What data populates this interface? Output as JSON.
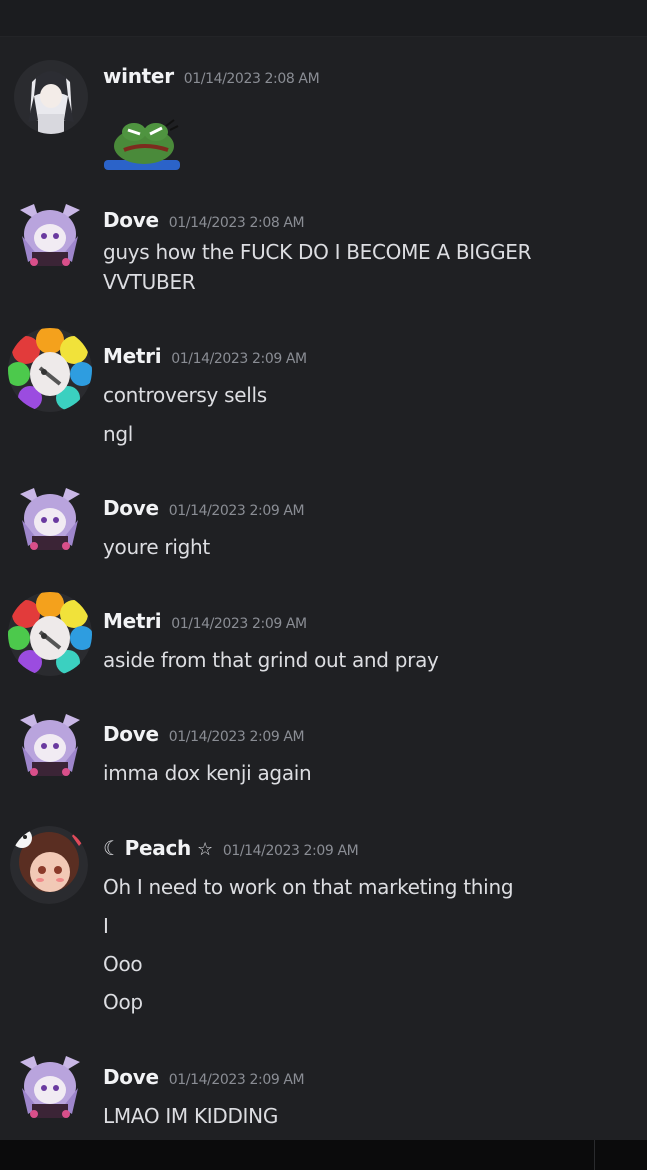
{
  "messages": [
    {
      "username": "winter",
      "timestamp": "01/14/2023 2:08 AM",
      "avatar": "winter-avatar",
      "lines": [],
      "emoji": "pepe-emoji"
    },
    {
      "username": "Dove",
      "timestamp": "01/14/2023 2:08 AM",
      "avatar": "dove-avatar",
      "lines": [
        "guys how the FUCK DO I BECOME A BIGGER",
        "VVTUBER"
      ]
    },
    {
      "username": "Metri",
      "timestamp": "01/14/2023 2:09 AM",
      "avatar": "metri-avatar",
      "lines": [
        "controversy sells",
        "ngl"
      ]
    },
    {
      "username": "Dove",
      "timestamp": "01/14/2023 2:09 AM",
      "avatar": "dove-avatar",
      "lines": [
        "youre right"
      ]
    },
    {
      "username": "Metri",
      "timestamp": "01/14/2023 2:09 AM",
      "avatar": "metri-avatar",
      "lines": [
        "aside from that grind out and pray"
      ]
    },
    {
      "username": "Dove",
      "timestamp": "01/14/2023 2:09 AM",
      "avatar": "dove-avatar",
      "lines": [
        "imma dox kenji again"
      ]
    },
    {
      "username": "Peach",
      "username_prefix": "☾",
      "username_suffix": "☆",
      "timestamp": "01/14/2023 2:09 AM",
      "avatar": "peach-avatar",
      "lines": [
        "Oh I need to work on that marketing thing",
        "I",
        "Ooo",
        "Oop"
      ]
    },
    {
      "username": "Dove",
      "timestamp": "01/14/2023 2:09 AM",
      "avatar": "dove-avatar",
      "lines": [
        "LMAO IM KIDDING"
      ]
    }
  ],
  "colors": {
    "background": "#1f2023",
    "username": "#f2f3f5",
    "text": "#dcdde1",
    "timestamp": "#8a8d94"
  }
}
